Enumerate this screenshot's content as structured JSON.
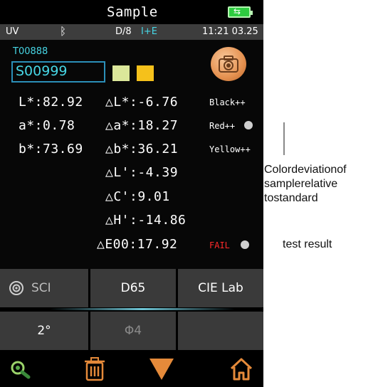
{
  "title": "Sample",
  "status": {
    "mode": "UV",
    "bluetooth_icon": "bluetooth-icon",
    "geometry": "D/8",
    "spec_mode": "I+E",
    "time": "11:21 03.25"
  },
  "standard_code": "T00888",
  "sample_code": "S00999",
  "swatches": {
    "standard_color": "#dbe79a",
    "sample_color": "#f5c11b"
  },
  "measurements": {
    "L": "L*:82.92",
    "a": "a*:0.78",
    "b": "b*:73.69",
    "dL": "△L*:-6.76",
    "da": "△a*:18.27",
    "db": "△b*:36.21",
    "dLp": "△L':-4.39",
    "dCp": "△C':9.01",
    "dHp": "△H':-14.86",
    "dE00": "△E00:17.92"
  },
  "deviation": {
    "l": "Black++",
    "a": "Red++",
    "b": "Yellow++"
  },
  "result": {
    "label": "FAIL",
    "color": "#ff2a2a"
  },
  "buttons": {
    "sci": "SCI",
    "illuminant": "D65",
    "color_space": "CIE Lab",
    "observer": "2°",
    "aperture": "Φ4"
  },
  "annotations": {
    "deviation_note": "Colordeviationof samplerelative tostandard",
    "result_note": "test result"
  },
  "colors": {
    "accent": "#47d6e5",
    "toolbar_icon": "#e58a3a",
    "fail": "#ff2a2a"
  }
}
